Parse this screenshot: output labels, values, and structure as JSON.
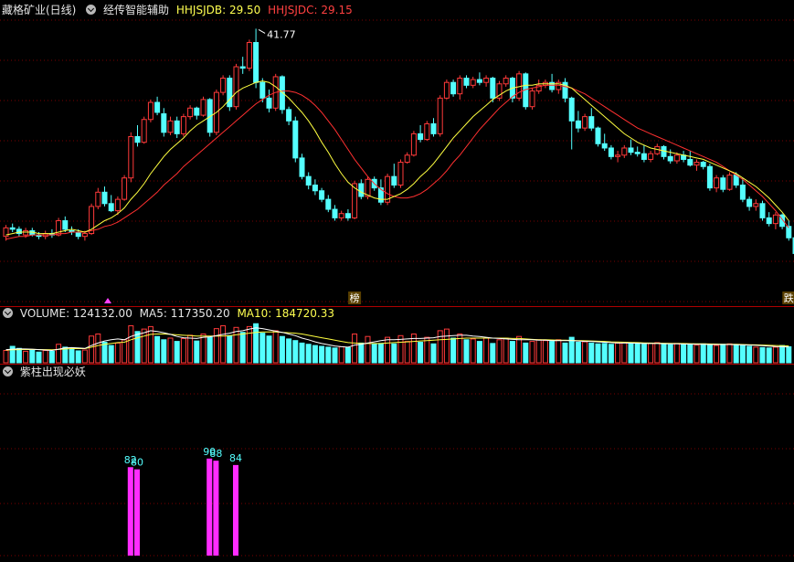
{
  "main_header": {
    "stock_name": "藏格矿业(日线)",
    "indicator_name": "经传智能辅助",
    "hhjsjdb": "HHJSJDB: 29.50",
    "hhjsjdc": "HHJSJDC: 29.15"
  },
  "volume_header": {
    "title": "VOLUME: 124132.00",
    "ma5": "MA5: 117350.20",
    "ma10": "MA10: 184720.33"
  },
  "signal_header": {
    "title": "紫柱出现必妖"
  },
  "colors": {
    "up": "#ff3a3a",
    "down": "#54ffff",
    "ma_short": "#ffff40",
    "ma_long": "#ff3030",
    "signal_bar": "#ff2cff",
    "signal_label": "#54ffff",
    "grid": "#7a0000"
  },
  "chart_data": [
    {
      "type": "candlestick",
      "annotations": [
        {
          "text": "41.77",
          "at_bar": 38
        },
        {
          "text": "榜",
          "at_bar": 53
        },
        {
          "text": "跌",
          "at_bar": 119
        }
      ],
      "ohlc": [
        [
          27.2,
          28.0,
          26.9,
          27.8
        ],
        [
          27.8,
          28.1,
          27.5,
          27.7
        ],
        [
          27.7,
          27.9,
          27.2,
          27.4
        ],
        [
          27.3,
          27.8,
          27.1,
          27.6
        ],
        [
          27.6,
          27.8,
          27.2,
          27.3
        ],
        [
          27.3,
          27.5,
          27.0,
          27.2
        ],
        [
          27.2,
          27.6,
          27.0,
          27.4
        ],
        [
          27.4,
          27.7,
          27.1,
          27.3
        ],
        [
          27.3,
          28.5,
          27.2,
          28.3
        ],
        [
          28.3,
          28.6,
          27.5,
          27.7
        ],
        [
          27.6,
          27.9,
          27.3,
          27.5
        ],
        [
          27.5,
          27.7,
          27.0,
          27.2
        ],
        [
          27.2,
          27.6,
          26.9,
          27.4
        ],
        [
          27.4,
          29.5,
          27.3,
          29.3
        ],
        [
          29.3,
          30.6,
          29.1,
          30.3
        ],
        [
          30.3,
          30.7,
          29.3,
          29.5
        ],
        [
          29.5,
          30.1,
          28.9,
          29.0
        ],
        [
          29.0,
          30.0,
          28.7,
          29.8
        ],
        [
          29.8,
          31.5,
          29.7,
          31.3
        ],
        [
          31.3,
          34.5,
          31.0,
          34.2
        ],
        [
          34.2,
          35.0,
          33.5,
          33.8
        ],
        [
          33.8,
          35.6,
          33.7,
          35.4
        ],
        [
          35.4,
          36.8,
          35.2,
          36.6
        ],
        [
          36.6,
          37.0,
          35.7,
          35.9
        ],
        [
          35.8,
          36.2,
          34.2,
          34.5
        ],
        [
          34.5,
          35.6,
          34.3,
          35.3
        ],
        [
          35.3,
          35.6,
          34.1,
          34.4
        ],
        [
          34.4,
          35.8,
          34.2,
          35.6
        ],
        [
          35.6,
          36.4,
          35.4,
          36.2
        ],
        [
          36.2,
          36.3,
          35.4,
          35.7
        ],
        [
          35.7,
          37.0,
          35.6,
          36.8
        ],
        [
          36.8,
          36.9,
          34.2,
          34.5
        ],
        [
          34.5,
          37.5,
          34.3,
          37.3
        ],
        [
          37.3,
          38.5,
          37.1,
          38.3
        ],
        [
          38.3,
          38.5,
          36.0,
          36.3
        ],
        [
          36.3,
          39.3,
          36.1,
          39.1
        ],
        [
          39.1,
          39.8,
          38.6,
          39.0
        ],
        [
          39.0,
          41.0,
          38.8,
          40.8
        ],
        [
          40.8,
          41.77,
          37.6,
          38.0
        ],
        [
          38.0,
          38.3,
          36.6,
          36.9
        ],
        [
          36.9,
          37.5,
          35.9,
          36.2
        ],
        [
          36.2,
          38.6,
          36.0,
          38.4
        ],
        [
          38.4,
          38.5,
          35.8,
          36.1
        ],
        [
          36.1,
          36.3,
          35.0,
          35.3
        ],
        [
          35.3,
          35.6,
          32.4,
          32.7
        ],
        [
          32.7,
          33.0,
          31.2,
          31.4
        ],
        [
          31.4,
          31.7,
          30.5,
          30.8
        ],
        [
          30.8,
          31.2,
          30.1,
          30.4
        ],
        [
          30.4,
          30.6,
          29.6,
          29.8
        ],
        [
          29.8,
          30.1,
          28.9,
          29.1
        ],
        [
          29.1,
          29.4,
          28.3,
          28.5
        ],
        [
          28.5,
          29.0,
          28.3,
          28.8
        ],
        [
          28.8,
          29.1,
          28.3,
          28.5
        ],
        [
          28.5,
          31.1,
          28.4,
          30.9
        ],
        [
          30.9,
          31.2,
          29.8,
          30.0
        ],
        [
          30.0,
          31.4,
          29.8,
          31.2
        ],
        [
          31.2,
          31.4,
          30.4,
          30.6
        ],
        [
          30.6,
          31.2,
          29.4,
          29.6
        ],
        [
          29.6,
          31.6,
          29.4,
          31.4
        ],
        [
          31.4,
          32.3,
          30.6,
          30.8
        ],
        [
          30.8,
          32.6,
          30.6,
          32.4
        ],
        [
          32.4,
          33.1,
          32.3,
          32.9
        ],
        [
          32.9,
          34.6,
          32.8,
          34.4
        ],
        [
          34.4,
          35.0,
          33.8,
          34.0
        ],
        [
          34.0,
          35.3,
          33.9,
          35.1
        ],
        [
          35.1,
          35.5,
          34.2,
          34.4
        ],
        [
          34.4,
          37.1,
          34.2,
          36.9
        ],
        [
          36.9,
          38.2,
          36.8,
          38.0
        ],
        [
          38.0,
          38.2,
          37.0,
          37.2
        ],
        [
          37.2,
          38.5,
          36.8,
          38.3
        ],
        [
          38.3,
          38.5,
          37.6,
          37.8
        ],
        [
          37.8,
          38.4,
          37.6,
          38.2
        ],
        [
          38.2,
          38.7,
          37.8,
          38.0
        ],
        [
          38.0,
          38.5,
          37.7,
          38.3
        ],
        [
          38.3,
          38.4,
          36.6,
          36.9
        ],
        [
          36.9,
          38.1,
          36.7,
          37.9
        ],
        [
          37.9,
          38.5,
          37.7,
          38.3
        ],
        [
          38.3,
          38.4,
          36.6,
          36.9
        ],
        [
          36.9,
          38.8,
          36.7,
          38.6
        ],
        [
          38.6,
          38.7,
          36.1,
          36.3
        ],
        [
          36.3,
          37.6,
          36.1,
          37.4
        ],
        [
          37.4,
          38.2,
          37.2,
          37.8
        ],
        [
          37.8,
          38.2,
          37.6,
          38.0
        ],
        [
          38.0,
          38.6,
          37.3,
          37.5
        ],
        [
          37.5,
          38.2,
          37.2,
          38.0
        ],
        [
          38.0,
          38.3,
          36.6,
          36.9
        ],
        [
          36.9,
          37.0,
          33.3,
          35.3
        ],
        [
          35.3,
          36.0,
          34.5,
          34.8
        ],
        [
          34.8,
          35.8,
          34.6,
          35.6
        ],
        [
          35.6,
          36.2,
          34.6,
          34.8
        ],
        [
          34.8,
          34.9,
          33.5,
          33.7
        ],
        [
          33.7,
          34.4,
          33.2,
          33.4
        ],
        [
          33.4,
          33.6,
          32.6,
          32.8
        ],
        [
          32.8,
          33.2,
          32.4,
          32.9
        ],
        [
          32.9,
          33.6,
          32.7,
          33.4
        ],
        [
          33.4,
          34.0,
          32.9,
          33.1
        ],
        [
          33.1,
          33.5,
          32.8,
          33.0
        ],
        [
          33.0,
          33.6,
          32.4,
          32.6
        ],
        [
          32.6,
          33.2,
          32.4,
          33.0
        ],
        [
          33.0,
          33.7,
          32.9,
          33.5
        ],
        [
          33.5,
          33.6,
          32.6,
          32.8
        ],
        [
          32.8,
          33.3,
          32.3,
          32.5
        ],
        [
          32.5,
          33.1,
          32.3,
          32.9
        ],
        [
          32.9,
          33.2,
          32.4,
          32.6
        ],
        [
          32.6,
          33.2,
          32.1,
          32.2
        ],
        [
          32.2,
          32.6,
          31.8,
          32.4
        ],
        [
          32.4,
          32.5,
          31.9,
          32.1
        ],
        [
          32.1,
          32.3,
          30.4,
          30.6
        ],
        [
          30.6,
          31.5,
          30.3,
          31.3
        ],
        [
          31.3,
          31.5,
          30.3,
          30.5
        ],
        [
          30.5,
          31.7,
          30.4,
          31.5
        ],
        [
          31.5,
          31.7,
          30.6,
          30.8
        ],
        [
          30.8,
          31.3,
          29.6,
          29.8
        ],
        [
          29.8,
          30.0,
          29.0,
          29.3
        ],
        [
          29.3,
          29.8,
          29.0,
          29.5
        ],
        [
          29.5,
          29.7,
          28.3,
          28.5
        ],
        [
          28.5,
          28.9,
          27.9,
          28.1
        ],
        [
          28.1,
          28.9,
          27.7,
          28.7
        ],
        [
          28.7,
          28.8,
          27.7,
          27.9
        ],
        [
          27.9,
          28.3,
          26.9,
          27.1
        ],
        [
          27.1,
          27.3,
          25.7,
          26.0
        ],
        [
          26.0,
          26.2,
          23.9,
          24.2
        ],
        [
          24.2,
          24.3,
          23.3,
          23.5
        ]
      ],
      "ma_short": [
        27.3,
        27.4,
        27.5,
        27.5,
        27.5,
        27.4,
        27.4,
        27.4,
        27.5,
        27.6,
        27.7,
        27.6,
        27.5,
        27.7,
        28.0,
        28.3,
        28.5,
        28.8,
        29.2,
        29.8,
        30.3,
        30.9,
        31.6,
        32.2,
        32.8,
        33.3,
        33.7,
        34.1,
        34.6,
        35.0,
        35.3,
        35.6,
        35.9,
        36.3,
        36.8,
        37.3,
        37.6,
        37.8,
        38.0,
        38.1,
        38.0,
        37.7,
        37.3,
        36.9,
        36.4,
        35.9,
        35.3,
        34.6,
        33.8,
        33.1,
        32.3,
        31.6,
        31.0,
        30.6,
        30.3,
        30.1,
        29.9,
        29.8,
        29.8,
        30.0,
        30.2,
        30.5,
        30.9,
        31.4,
        31.8,
        32.3,
        32.9,
        33.5,
        34.1,
        34.6,
        35.1,
        35.6,
        36.0,
        36.4,
        36.8,
        37.1,
        37.4,
        37.6,
        37.7,
        37.8,
        37.8,
        37.9,
        37.9,
        37.9,
        37.9,
        37.8,
        37.6,
        37.2,
        36.8,
        36.4,
        36.0,
        35.6,
        35.2,
        34.8,
        34.4,
        34.1,
        33.8,
        33.6,
        33.4,
        33.3,
        33.2,
        33.1,
        33.0,
        32.9,
        32.8,
        32.7,
        32.6,
        32.4,
        32.2,
        32.0,
        31.8,
        31.6,
        31.3,
        31.0,
        30.7,
        30.3,
        29.9,
        29.4,
        28.9,
        28.3
      ],
      "ma_long": [
        27.0,
        27.1,
        27.2,
        27.2,
        27.3,
        27.3,
        27.3,
        27.3,
        27.4,
        27.4,
        27.5,
        27.5,
        27.5,
        27.6,
        27.7,
        27.9,
        28.0,
        28.2,
        28.5,
        28.8,
        29.1,
        29.5,
        29.9,
        30.3,
        30.8,
        31.2,
        31.6,
        32.1,
        32.5,
        32.9,
        33.3,
        33.7,
        34.1,
        34.5,
        34.9,
        35.3,
        35.7,
        36.1,
        36.5,
        36.8,
        37.1,
        37.3,
        37.4,
        37.4,
        37.3,
        37.1,
        36.8,
        36.4,
        35.9,
        35.3,
        34.7,
        34.0,
        33.3,
        32.6,
        32.0,
        31.4,
        30.9,
        30.5,
        30.2,
        30.0,
        29.9,
        29.9,
        30.0,
        30.2,
        30.5,
        30.9,
        31.3,
        31.8,
        32.4,
        32.9,
        33.5,
        34.1,
        34.7,
        35.2,
        35.7,
        36.2,
        36.6,
        37.0,
        37.3,
        37.5,
        37.6,
        37.7,
        37.8,
        37.8,
        37.8,
        37.7,
        37.6,
        37.4,
        37.2,
        36.9,
        36.6,
        36.3,
        36.0,
        35.7,
        35.4,
        35.1,
        34.8,
        34.6,
        34.4,
        34.2,
        34.0,
        33.8,
        33.6,
        33.4,
        33.2,
        33.0,
        32.8,
        32.6,
        32.4,
        32.1,
        31.8,
        31.5,
        31.2,
        30.8,
        30.4,
        30.0,
        29.5,
        29.0,
        28.4,
        27.8
      ]
    },
    {
      "type": "bar",
      "volume": [
        300,
        400,
        350,
        280,
        320,
        260,
        300,
        280,
        450,
        380,
        330,
        290,
        310,
        650,
        700,
        500,
        420,
        480,
        560,
        900,
        760,
        820,
        880,
        640,
        560,
        600,
        520,
        590,
        670,
        530,
        700,
        620,
        830,
        900,
        660,
        860,
        740,
        880,
        950,
        720,
        650,
        780,
        640,
        580,
        540,
        480,
        450,
        420,
        400,
        380,
        360,
        390,
        370,
        700,
        480,
        640,
        460,
        470,
        620,
        460,
        660,
        520,
        700,
        500,
        620,
        460,
        780,
        820,
        600,
        700,
        560,
        580,
        520,
        600,
        470,
        560,
        600,
        520,
        640,
        480,
        520,
        560,
        540,
        520,
        560,
        480,
        620,
        500,
        510,
        480,
        460,
        470,
        450,
        480,
        490,
        470,
        460,
        450,
        470,
        490,
        450,
        440,
        470,
        460,
        450,
        430,
        460,
        440,
        420,
        450,
        460,
        440,
        420,
        400,
        380,
        370,
        360,
        380,
        420,
        390
      ],
      "ma5": [
        320,
        330,
        340,
        335,
        330,
        320,
        310,
        300,
        330,
        360,
        370,
        360,
        350,
        420,
        480,
        530,
        560,
        580,
        560,
        640,
        690,
        730,
        780,
        760,
        730,
        690,
        640,
        610,
        600,
        590,
        620,
        630,
        660,
        690,
        720,
        760,
        780,
        820,
        850,
        830,
        800,
        770,
        740,
        700,
        660,
        600,
        560,
        510,
        470,
        440,
        410,
        390,
        380,
        430,
        450,
        480,
        510,
        540,
        560,
        560,
        570,
        580,
        590,
        590,
        600,
        610,
        640,
        650,
        660,
        670,
        670,
        650,
        640,
        620,
        600,
        590,
        580,
        570,
        560,
        560,
        560,
        550,
        550,
        540,
        540,
        540,
        540,
        530,
        520,
        520,
        510,
        500,
        490,
        480,
        480,
        480,
        475,
        470,
        470,
        470,
        465,
        460,
        460,
        455,
        455,
        450,
        450,
        445,
        445,
        445,
        445,
        440,
        435,
        430,
        425,
        415,
        405,
        395,
        390,
        385
      ],
      "ma10": [
        310,
        315,
        320,
        322,
        324,
        322,
        320,
        318,
        325,
        335,
        345,
        345,
        345,
        380,
        420,
        450,
        470,
        490,
        500,
        560,
        610,
        650,
        690,
        700,
        700,
        690,
        680,
        670,
        660,
        650,
        650,
        650,
        650,
        650,
        660,
        680,
        700,
        720,
        740,
        750,
        750,
        750,
        740,
        730,
        720,
        700,
        670,
        640,
        610,
        580,
        550,
        520,
        490,
        480,
        470,
        470,
        470,
        470,
        480,
        490,
        500,
        510,
        520,
        530,
        540,
        550,
        560,
        570,
        580,
        590,
        600,
        600,
        600,
        600,
        600,
        600,
        600,
        590,
        590,
        580,
        570,
        560,
        560,
        555,
        550,
        550,
        545,
        540,
        535,
        530,
        525,
        520,
        510,
        505,
        500,
        495,
        490,
        485,
        480,
        478,
        475,
        472,
        470,
        468,
        465,
        462,
        460,
        458,
        455,
        452,
        450,
        448,
        445,
        440,
        435,
        430,
        425,
        420,
        415,
        410
      ]
    },
    {
      "type": "bar",
      "signals": [
        {
          "bar": 19,
          "value": 82,
          "label": "82"
        },
        {
          "bar": 20,
          "value": 80,
          "label": "80"
        },
        {
          "bar": 31,
          "value": 90,
          "label": "90"
        },
        {
          "bar": 32,
          "value": 88,
          "label": "88"
        },
        {
          "bar": 35,
          "value": 84,
          "label": "84"
        }
      ]
    }
  ]
}
